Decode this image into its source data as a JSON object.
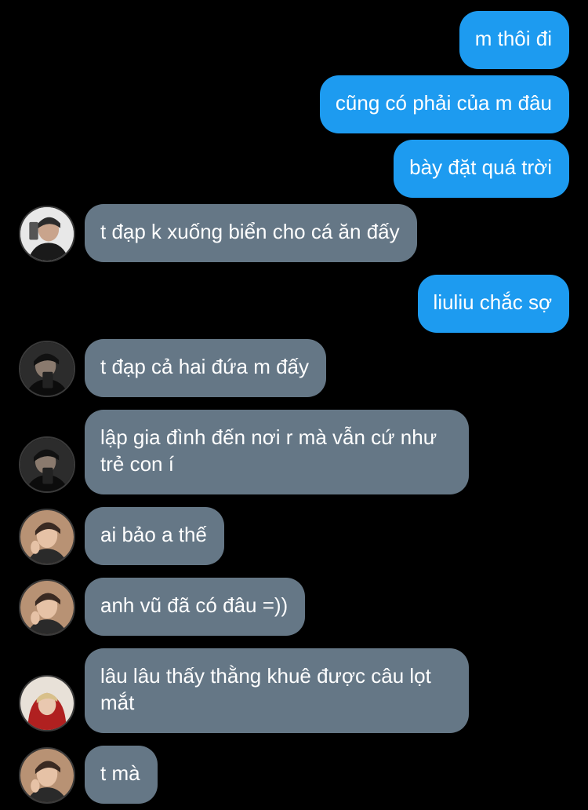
{
  "colors": {
    "background": "#000000",
    "outgoing_bubble": "#1d9bf0",
    "incoming_bubble": "#657786",
    "text": "#ffffff"
  },
  "messages": [
    {
      "direction": "outgoing",
      "text": "m thôi đi"
    },
    {
      "direction": "outgoing",
      "text": "cũng có phải của m đâu"
    },
    {
      "direction": "outgoing",
      "text": "bày đặt quá trời"
    },
    {
      "direction": "incoming",
      "avatar": "user-avatar-1",
      "text": "t đạp k xuống biển cho cá ăn đấy"
    },
    {
      "direction": "outgoing",
      "text": "liuliu chắc sợ"
    },
    {
      "direction": "incoming",
      "avatar": "user-avatar-2",
      "text": "t đạp cả hai đứa m đấy"
    },
    {
      "direction": "incoming",
      "avatar": "user-avatar-2",
      "text": "lập gia đình đến nơi r mà vẫn cứ như trẻ con í"
    },
    {
      "direction": "incoming",
      "avatar": "user-avatar-3",
      "text": "ai bảo a thế"
    },
    {
      "direction": "incoming",
      "avatar": "user-avatar-3",
      "text": "anh vũ đã có đâu =))"
    },
    {
      "direction": "incoming",
      "avatar": "user-avatar-4",
      "text": "lâu lâu thấy thằng khuê được câu lọt mắt"
    },
    {
      "direction": "incoming",
      "avatar": "user-avatar-3",
      "text": "t mà"
    }
  ]
}
